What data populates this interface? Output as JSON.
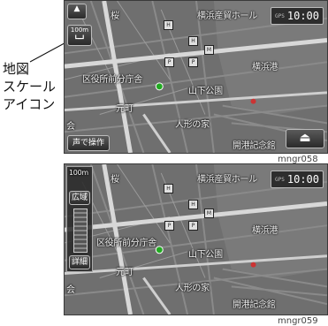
{
  "callout": {
    "line1": "地図",
    "line2": "スケール",
    "line3": "アイコン"
  },
  "screen1": {
    "clock": "10:00",
    "scale_label": "100m",
    "voice_button_label": "声で操作",
    "labels": {
      "place_a": "桜",
      "place_b": "横浜産貿ホール",
      "place_c": "横浜港",
      "place_d": "区役所前分庁舎",
      "place_e": "山下公園",
      "place_f": "元町",
      "place_g": "人形の家",
      "place_h": "開港記念館",
      "place_i": "会"
    }
  },
  "screen2": {
    "clock": "10:00",
    "scale_label": "100m",
    "wide_button_label": "広域",
    "detail_button_label": "詳細",
    "labels": {
      "place_a": "桜",
      "place_b": "横浜産貿ホール",
      "place_c": "横浜港",
      "place_d": "区役所前分庁舎",
      "place_e": "山下公園",
      "place_f": "元町",
      "place_g": "人形の家",
      "place_h": "開港記念館",
      "place_i": "会"
    }
  },
  "captions": {
    "top": "mngr058",
    "bottom": "mngr059"
  }
}
